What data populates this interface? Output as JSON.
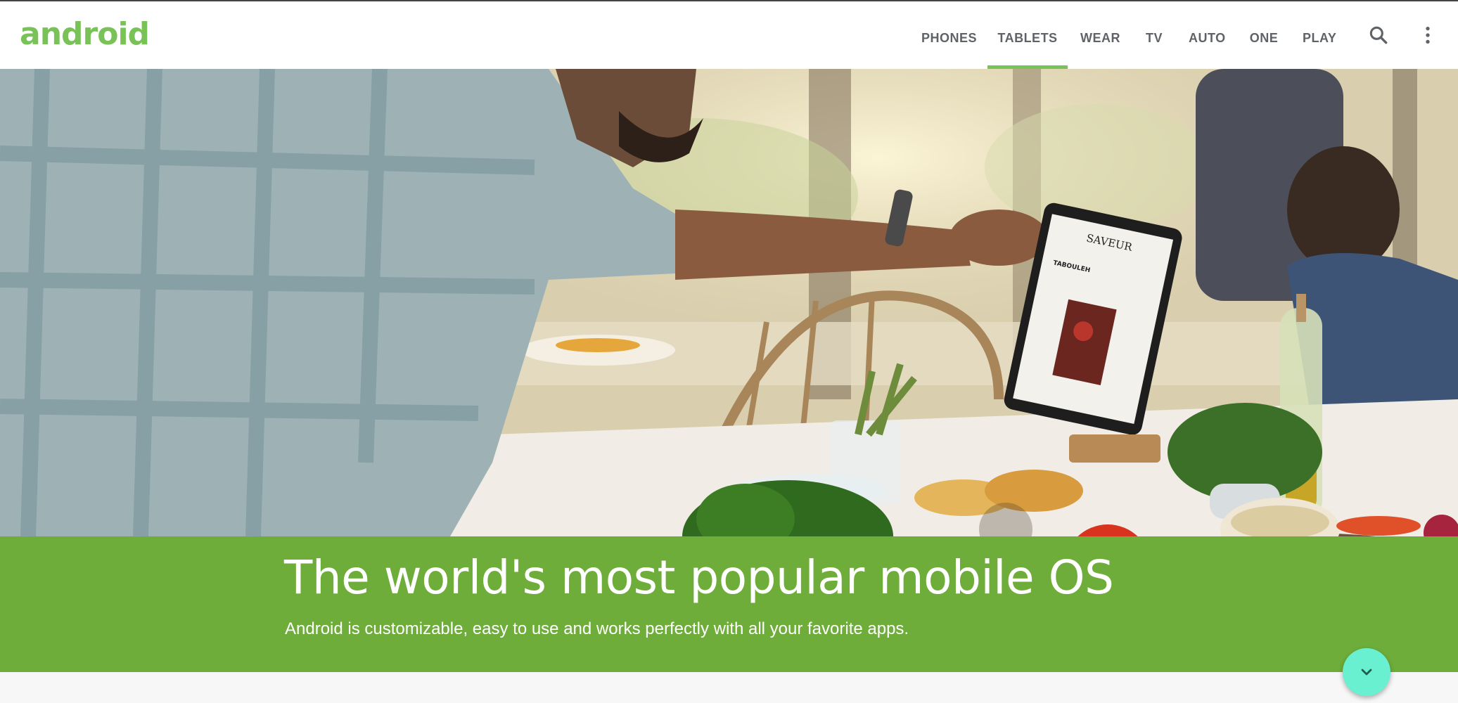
{
  "brand": {
    "logo_text": "android",
    "accent_color": "#78c257"
  },
  "nav": {
    "items": [
      {
        "label": "PHONES",
        "active": false
      },
      {
        "label": "TABLETS",
        "active": true
      },
      {
        "label": "WEAR",
        "active": false
      },
      {
        "label": "TV",
        "active": false
      },
      {
        "label": "AUTO",
        "active": false
      },
      {
        "label": "ONE",
        "active": false
      },
      {
        "label": "PLAY",
        "active": false
      }
    ],
    "icons": [
      "search-icon",
      "more-vert-icon"
    ]
  },
  "hero": {
    "tablet_screen_title": "SAVEUR",
    "tablet_screen_subtitle": "TABOULEH"
  },
  "banner": {
    "headline": "The world's most popular mobile OS",
    "subhead": "Android is customizable, easy to use and works perfectly with all your favorite apps.",
    "background_color": "#6ead3a"
  },
  "fab": {
    "icon": "chevron-down-icon",
    "color": "#69f0d0"
  }
}
